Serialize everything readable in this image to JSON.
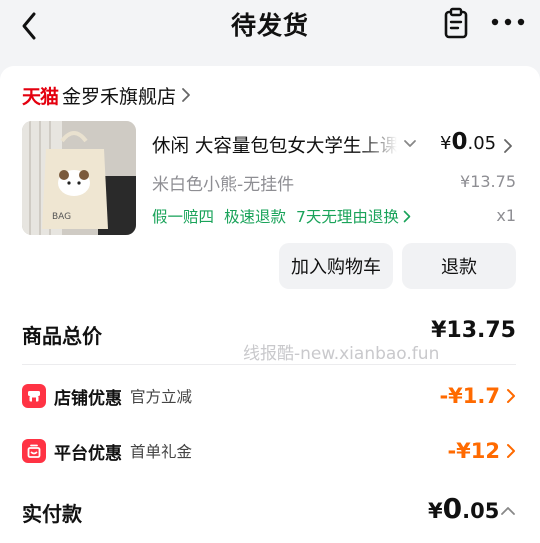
{
  "header": {
    "title": "待发货"
  },
  "shop": {
    "platform": "天猫",
    "name": "金罗禾旗舰店"
  },
  "product": {
    "title": "休闲 大容量包包女大学生上课通勤帆布包",
    "price_symbol": "¥",
    "price_int": "0",
    "price_dec": ".05",
    "original_price": "¥13.75",
    "variant": "米白色小熊-无挂件",
    "tags": [
      "假一赔四",
      "极速退款",
      "7天无理由退换"
    ],
    "quantity": "x1"
  },
  "actions": {
    "add_cart": "加入购物车",
    "refund": "退款"
  },
  "summary": {
    "total_label": "商品总价",
    "total_value": "¥13.75"
  },
  "watermark": "线报酷-new.xianbao.fun",
  "discounts": [
    {
      "title": "店铺优惠",
      "subtitle": "官方立减",
      "amount": "-¥1.7",
      "icon": "store-icon"
    },
    {
      "title": "平台优惠",
      "subtitle": "首单礼金",
      "amount": "-¥12",
      "icon": "gift-icon"
    }
  ],
  "payment": {
    "label": "实付款",
    "symbol": "¥",
    "int": "0",
    "dec": ".05"
  },
  "colors": {
    "tmall_red": "#e4000f",
    "tag_green": "#1aa35a",
    "discount_orange": "#ff6a00",
    "discount_icon_red": "#ff3344",
    "background": "#f3f4f6"
  }
}
